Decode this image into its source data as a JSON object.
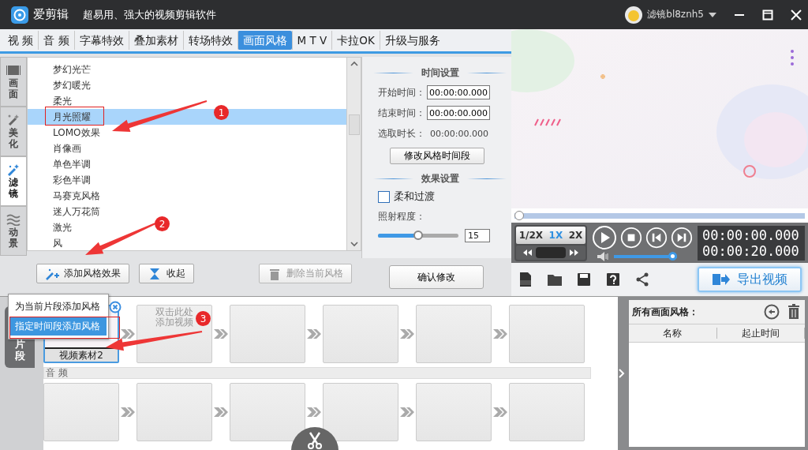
{
  "app": {
    "title": "爱剪辑",
    "slogan": "超易用、强大的视频剪辑软件",
    "user": "滤镜bl8znh5"
  },
  "tabs": [
    {
      "label": "视 频",
      "selected": false
    },
    {
      "label": "音 频",
      "selected": false
    },
    {
      "label": "字幕特效",
      "selected": false
    },
    {
      "label": "叠加素材",
      "selected": false
    },
    {
      "label": "转场特效",
      "selected": false
    },
    {
      "label": "画面风格",
      "selected": true
    },
    {
      "label": "M T V",
      "selected": false
    },
    {
      "label": "卡拉OK",
      "selected": false
    },
    {
      "label": "升级与服务",
      "selected": false
    }
  ],
  "side_tabs": [
    {
      "label": "画面",
      "kind": "film",
      "selected": false
    },
    {
      "label": "美化",
      "kind": "wand",
      "selected": false
    },
    {
      "label": "滤镜",
      "kind": "magic",
      "selected": true
    },
    {
      "label": "动景",
      "kind": "waves",
      "selected": false
    }
  ],
  "filters": [
    {
      "label": "梦幻光芒",
      "selected": false
    },
    {
      "label": "梦幻暖光",
      "selected": false
    },
    {
      "label": "柔光",
      "selected": false
    },
    {
      "label": "月光照耀",
      "selected": true
    },
    {
      "label": "LOMO效果",
      "selected": false
    },
    {
      "label": "肖像画",
      "selected": false
    },
    {
      "label": "单色半调",
      "selected": false
    },
    {
      "label": "彩色半调",
      "selected": false
    },
    {
      "label": "马赛克风格",
      "selected": false
    },
    {
      "label": "迷人万花筒",
      "selected": false
    },
    {
      "label": "激光",
      "selected": false
    },
    {
      "label": "风",
      "selected": false
    }
  ],
  "list_buttons": [
    {
      "kind": "add",
      "label": "添加风格效果",
      "disabled": false
    },
    {
      "kind": "collapse",
      "label": "收起",
      "disabled": false
    },
    {
      "kind": "delete",
      "label": "删除当前风格",
      "disabled": true
    }
  ],
  "time_settings": {
    "heading": "时间设置",
    "fields": [
      {
        "label": "开始时间：",
        "value": "00:00:00.000",
        "kind": "input"
      },
      {
        "label": "结束时间：",
        "value": "00:00:00.000",
        "kind": "input"
      },
      {
        "label": "选取时长：",
        "value": "00:00:00.000",
        "kind": "text"
      }
    ],
    "button": "修改风格时间段"
  },
  "effect_settings": {
    "heading": "效果设置",
    "soft": {
      "label": "柔和过渡",
      "checked": false
    },
    "intensity": {
      "label": "照射程度：",
      "level": 0.5,
      "value": "15"
    }
  },
  "confirm_button": "确认修改",
  "player": {
    "progress": {
      "level": 0
    },
    "speeds": [
      {
        "label": "1/2X",
        "selected": false
      },
      {
        "label": "1X",
        "selected": true
      },
      {
        "label": "2X",
        "selected": false
      }
    ],
    "volume": {
      "level": 1
    },
    "time_current": "00:00:00.000",
    "time_total": "00:00:20.000"
  },
  "export_button": "导出视频",
  "timeline": {
    "side_tab": "片段",
    "video": [
      {
        "kind": "clip",
        "label": "视频素材2",
        "selected": true
      },
      {
        "kind": "add",
        "hint": [
          "双击此处",
          "添加视频"
        ]
      },
      {
        "kind": "empty"
      },
      {
        "kind": "empty"
      },
      {
        "kind": "empty"
      },
      {
        "kind": "empty"
      }
    ],
    "audio_label": "音 频",
    "audio": [
      {
        "kind": "empty"
      },
      {
        "kind": "empty"
      },
      {
        "kind": "empty"
      },
      {
        "kind": "empty"
      },
      {
        "kind": "empty"
      },
      {
        "kind": "empty"
      }
    ]
  },
  "context_menu": [
    {
      "label": "为当前片段添加风格",
      "selected": false
    },
    {
      "label": "指定时间段添加风格",
      "selected": true
    }
  ],
  "styles_panel": {
    "title": "所有画面风格：",
    "columns": [
      "名称",
      "起止时间"
    ]
  },
  "annotations": [
    {
      "number": "1"
    },
    {
      "number": "2"
    },
    {
      "number": "3"
    }
  ]
}
